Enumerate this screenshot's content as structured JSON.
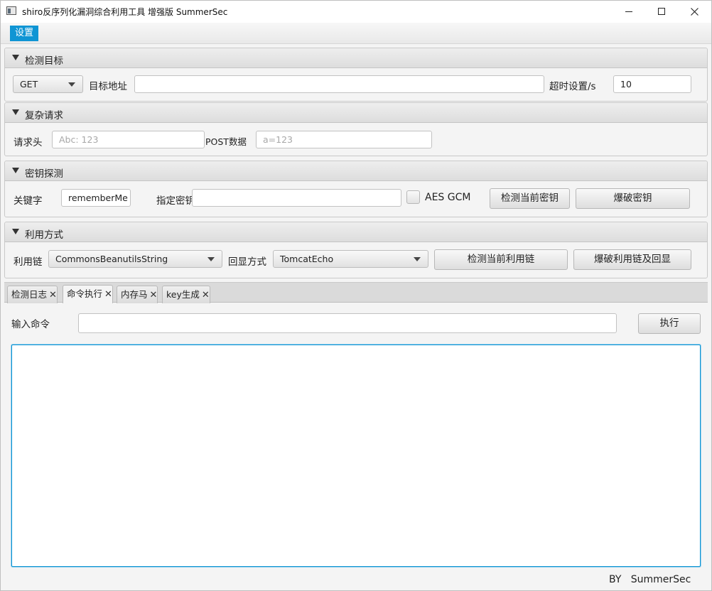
{
  "window": {
    "title": "shiro反序列化漏洞综合利用工具 增强版 SummerSec"
  },
  "menu": {
    "settings_label": "设置"
  },
  "target_pane": {
    "title": "检测目标",
    "method": "GET",
    "url_label": "目标地址",
    "url_value": "",
    "timeout_label": "超时设置/s",
    "timeout_value": "10"
  },
  "request_pane": {
    "title": "复杂请求",
    "header_label": "请求头",
    "header_placeholder": "Abc: 123",
    "post_label": "POST数据",
    "post_placeholder": "a=123"
  },
  "key_pane": {
    "title": "密钥探测",
    "keyword_label": "关键字",
    "keyword_value": "rememberMe",
    "key_label": "指定密钥",
    "key_value": "",
    "aes_gcm_label": "AES GCM",
    "aes_gcm_checked": false,
    "detect_key_button": "检测当前密钥",
    "brute_key_button": "爆破密钥"
  },
  "exploit_pane": {
    "title": "利用方式",
    "chain_label": "利用链",
    "chain_value": "CommonsBeanutilsString",
    "echo_label": "回显方式",
    "echo_value": "TomcatEcho",
    "detect_chain_button": "检测当前利用链",
    "brute_chain_button": "爆破利用链及回显"
  },
  "tabs": [
    {
      "label": "检测日志",
      "active": false
    },
    {
      "label": "命令执行",
      "active": true
    },
    {
      "label": "内存马",
      "active": false
    },
    {
      "label": "key生成",
      "active": false
    }
  ],
  "command": {
    "input_label": "输入命令",
    "input_value": "",
    "execute_button": "执行",
    "output": ""
  },
  "footer": {
    "text": "BY   SummerSec"
  },
  "colors": {
    "accent": "#0f95d4",
    "focus_border": "#0a93d2"
  }
}
